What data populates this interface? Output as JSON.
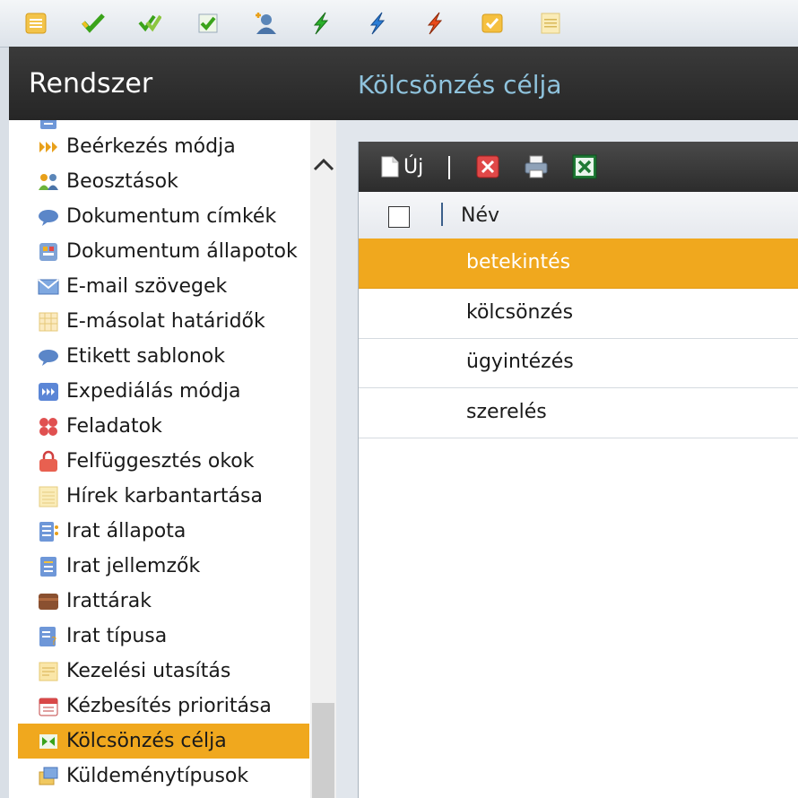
{
  "toolbar": {
    "icons": [
      "list-icon",
      "check-green-icon",
      "check-double-icon",
      "checkbox-icon",
      "user-add-icon",
      "lightning-green-icon",
      "lightning-blue-icon",
      "lightning-red-icon",
      "envelope-check-icon",
      "notepad-icon"
    ]
  },
  "sidebar": {
    "title": "Rendszer",
    "items": [
      {
        "label": "Beérkezés módja",
        "icon": "arrows-right-icon"
      },
      {
        "label": "Beosztások",
        "icon": "users-icon"
      },
      {
        "label": "Dokumentum címkék",
        "icon": "speech-bubble-icon"
      },
      {
        "label": "Dokumentum állapotok",
        "icon": "document-status-icon"
      },
      {
        "label": "E-mail szövegek",
        "icon": "envelope-icon"
      },
      {
        "label": "E-másolat határidők",
        "icon": "calendar-grid-icon"
      },
      {
        "label": "Etikett sablonok",
        "icon": "speech-bubble-icon"
      },
      {
        "label": "Expediálás módja",
        "icon": "arrows-blue-icon"
      },
      {
        "label": "Feladatok",
        "icon": "four-dots-icon"
      },
      {
        "label": "Felfüggesztés okok",
        "icon": "lock-icon"
      },
      {
        "label": "Hírek karbantartása",
        "icon": "notepad-icon"
      },
      {
        "label": "Irat állapota",
        "icon": "document-list-icon"
      },
      {
        "label": "Irat jellemzők",
        "icon": "document-icon"
      },
      {
        "label": "Irattárak",
        "icon": "archive-icon"
      },
      {
        "label": "Irat típusa",
        "icon": "document-question-icon"
      },
      {
        "label": "Kezelési utasítás",
        "icon": "note-icon"
      },
      {
        "label": "Kézbesítés prioritása",
        "icon": "calendar-red-icon"
      },
      {
        "label": "Kölcsönzés célja",
        "icon": "exchange-icon",
        "selected": true
      },
      {
        "label": "Küldeménytípusok",
        "icon": "package-icon"
      }
    ]
  },
  "main": {
    "title": "Kölcsönzés célja",
    "grid_toolbar": {
      "new_label": "Új",
      "buttons": [
        "delete-icon",
        "print-icon",
        "excel-icon"
      ]
    },
    "column_header": "Név",
    "rows": [
      {
        "name": "betekintés",
        "selected": true
      },
      {
        "name": "kölcsönzés"
      },
      {
        "name": "ügyintézés"
      },
      {
        "name": "szerelés"
      }
    ]
  },
  "colors": {
    "accent": "#f0a81e",
    "header_dark": "#2e2e2e",
    "title_blue": "#8fc3dd"
  }
}
